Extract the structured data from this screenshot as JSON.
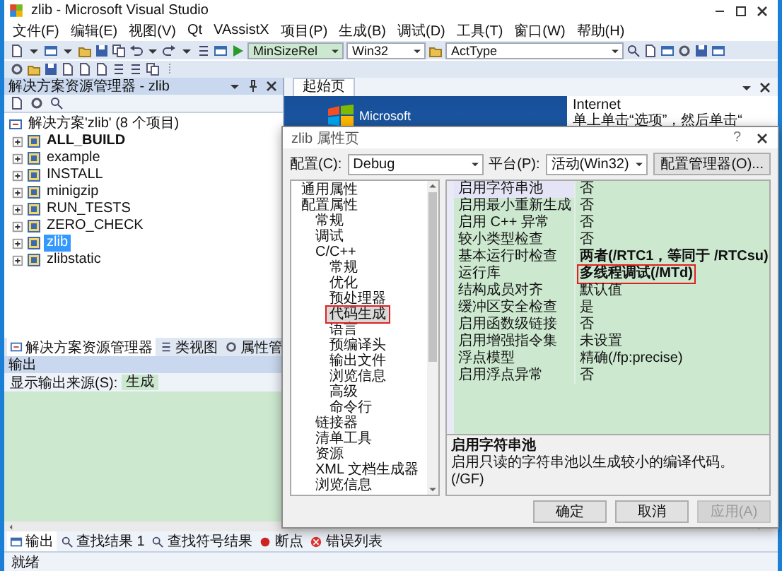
{
  "window": {
    "title": "zlib - Microsoft Visual Studio"
  },
  "menu": [
    "文件(F)",
    "编辑(E)",
    "视图(V)",
    "Qt",
    "VAssistX",
    "项目(P)",
    "生成(B)",
    "调试(D)",
    "工具(T)",
    "窗口(W)",
    "帮助(H)"
  ],
  "toolbar": {
    "configuration": "MinSizeRel",
    "platform": "Win32",
    "find": "ActType"
  },
  "solution_explorer": {
    "title": "解决方案资源管理器 - zlib",
    "items": [
      {
        "kind": "solution",
        "label": "解决方案'zlib' (8 个项目)",
        "bold": false,
        "selected": false
      },
      {
        "kind": "project",
        "label": "ALL_BUILD",
        "bold": true,
        "selected": false
      },
      {
        "kind": "project",
        "label": "example",
        "bold": false,
        "selected": false
      },
      {
        "kind": "project",
        "label": "INSTALL",
        "bold": false,
        "selected": false
      },
      {
        "kind": "project",
        "label": "minigzip",
        "bold": false,
        "selected": false
      },
      {
        "kind": "project",
        "label": "RUN_TESTS",
        "bold": false,
        "selected": false
      },
      {
        "kind": "project",
        "label": "ZERO_CHECK",
        "bold": false,
        "selected": false
      },
      {
        "kind": "project",
        "label": "zlib",
        "bold": false,
        "selected": true
      },
      {
        "kind": "project",
        "label": "zlibstatic",
        "bold": false,
        "selected": false
      }
    ],
    "tabs": [
      {
        "label": "解决方案资源管理器",
        "selected": true
      },
      {
        "label": "类视图",
        "selected": false
      },
      {
        "label": "属性管",
        "selected": false
      }
    ]
  },
  "start_page": {
    "tab": "起始页",
    "logo": "Microsoft",
    "lines": [
      "Internet",
      "单上单击“选项”，然后单击“"
    ]
  },
  "output": {
    "title": "输出",
    "source_label": "显示输出来源(S):",
    "source": "生成",
    "tabs": [
      {
        "label": "输出",
        "selected": true
      },
      {
        "label": "查找结果 1",
        "selected": false
      },
      {
        "label": "查找符号结果",
        "selected": false
      },
      {
        "label": "断点",
        "selected": false
      },
      {
        "label": "错误列表",
        "selected": false
      }
    ]
  },
  "status_bar": "就绪",
  "dialog": {
    "title": "zlib 属性页",
    "help": "?",
    "config_label": "配置(C):",
    "config": "Debug",
    "platform_label": "平台(P):",
    "platform": "活动(Win32)",
    "manager_button": "配置管理器(O)...",
    "tree": [
      {
        "label": "通用属性",
        "selected": false,
        "marked": false
      },
      {
        "label": "配置属性",
        "selected": false,
        "marked": false,
        "children": [
          {
            "label": "常规",
            "selected": false,
            "marked": false
          },
          {
            "label": "调试",
            "selected": false,
            "marked": false
          },
          {
            "label": "C/C++",
            "selected": false,
            "marked": false,
            "children": [
              {
                "label": "常规",
                "selected": false,
                "marked": false
              },
              {
                "label": "优化",
                "selected": false,
                "marked": false
              },
              {
                "label": "预处理器",
                "selected": false,
                "marked": false
              },
              {
                "label": "代码生成",
                "selected": true,
                "marked": true
              },
              {
                "label": "语言",
                "selected": false,
                "marked": false
              },
              {
                "label": "预编译头",
                "selected": false,
                "marked": false
              },
              {
                "label": "输出文件",
                "selected": false,
                "marked": false
              },
              {
                "label": "浏览信息",
                "selected": false,
                "marked": false
              },
              {
                "label": "高级",
                "selected": false,
                "marked": false
              },
              {
                "label": "命令行",
                "selected": false,
                "marked": false
              }
            ]
          },
          {
            "label": "链接器",
            "selected": false,
            "marked": false
          },
          {
            "label": "清单工具",
            "selected": false,
            "marked": false
          },
          {
            "label": "资源",
            "selected": false,
            "marked": false
          },
          {
            "label": "XML 文档生成器",
            "selected": false,
            "marked": false
          },
          {
            "label": "浏览信息",
            "selected": false,
            "marked": false
          }
        ]
      }
    ],
    "properties": [
      {
        "name": "启用字符串池",
        "value": "否",
        "bold": false,
        "selected": true,
        "marked": false
      },
      {
        "name": "启用最小重新生成",
        "value": "否",
        "bold": false,
        "selected": false,
        "marked": false
      },
      {
        "name": "启用 C++ 异常",
        "value": "否",
        "bold": false,
        "selected": false,
        "marked": false
      },
      {
        "name": "较小类型检查",
        "value": "否",
        "bold": false,
        "selected": false,
        "marked": false
      },
      {
        "name": "基本运行时检查",
        "value": "两者(/RTC1，等同于 /RTCsu)",
        "bold": true,
        "selected": false,
        "marked": false
      },
      {
        "name": "运行库",
        "value": "多线程调试(/MTd)",
        "bold": true,
        "selected": false,
        "marked": true
      },
      {
        "name": "结构成员对齐",
        "value": "默认值",
        "bold": false,
        "selected": false,
        "marked": false
      },
      {
        "name": "缓冲区安全检查",
        "value": "是",
        "bold": false,
        "selected": false,
        "marked": false
      },
      {
        "name": "启用函数级链接",
        "value": "否",
        "bold": false,
        "selected": false,
        "marked": false
      },
      {
        "name": "启用增强指令集",
        "value": "未设置",
        "bold": false,
        "selected": false,
        "marked": false
      },
      {
        "name": "浮点模型",
        "value": "精确(/fp:precise)",
        "bold": false,
        "selected": false,
        "marked": false
      },
      {
        "name": "启用浮点异常",
        "value": "否",
        "bold": false,
        "selected": false,
        "marked": false
      }
    ],
    "description": {
      "title": "启用字符串池",
      "text": "启用只读的字符串池以生成较小的编译代码。",
      "switch": "(/GF)"
    },
    "buttons": [
      {
        "label": "确定",
        "disabled": false
      },
      {
        "label": "取消",
        "disabled": false
      },
      {
        "label": "应用(A)",
        "disabled": true
      }
    ]
  }
}
